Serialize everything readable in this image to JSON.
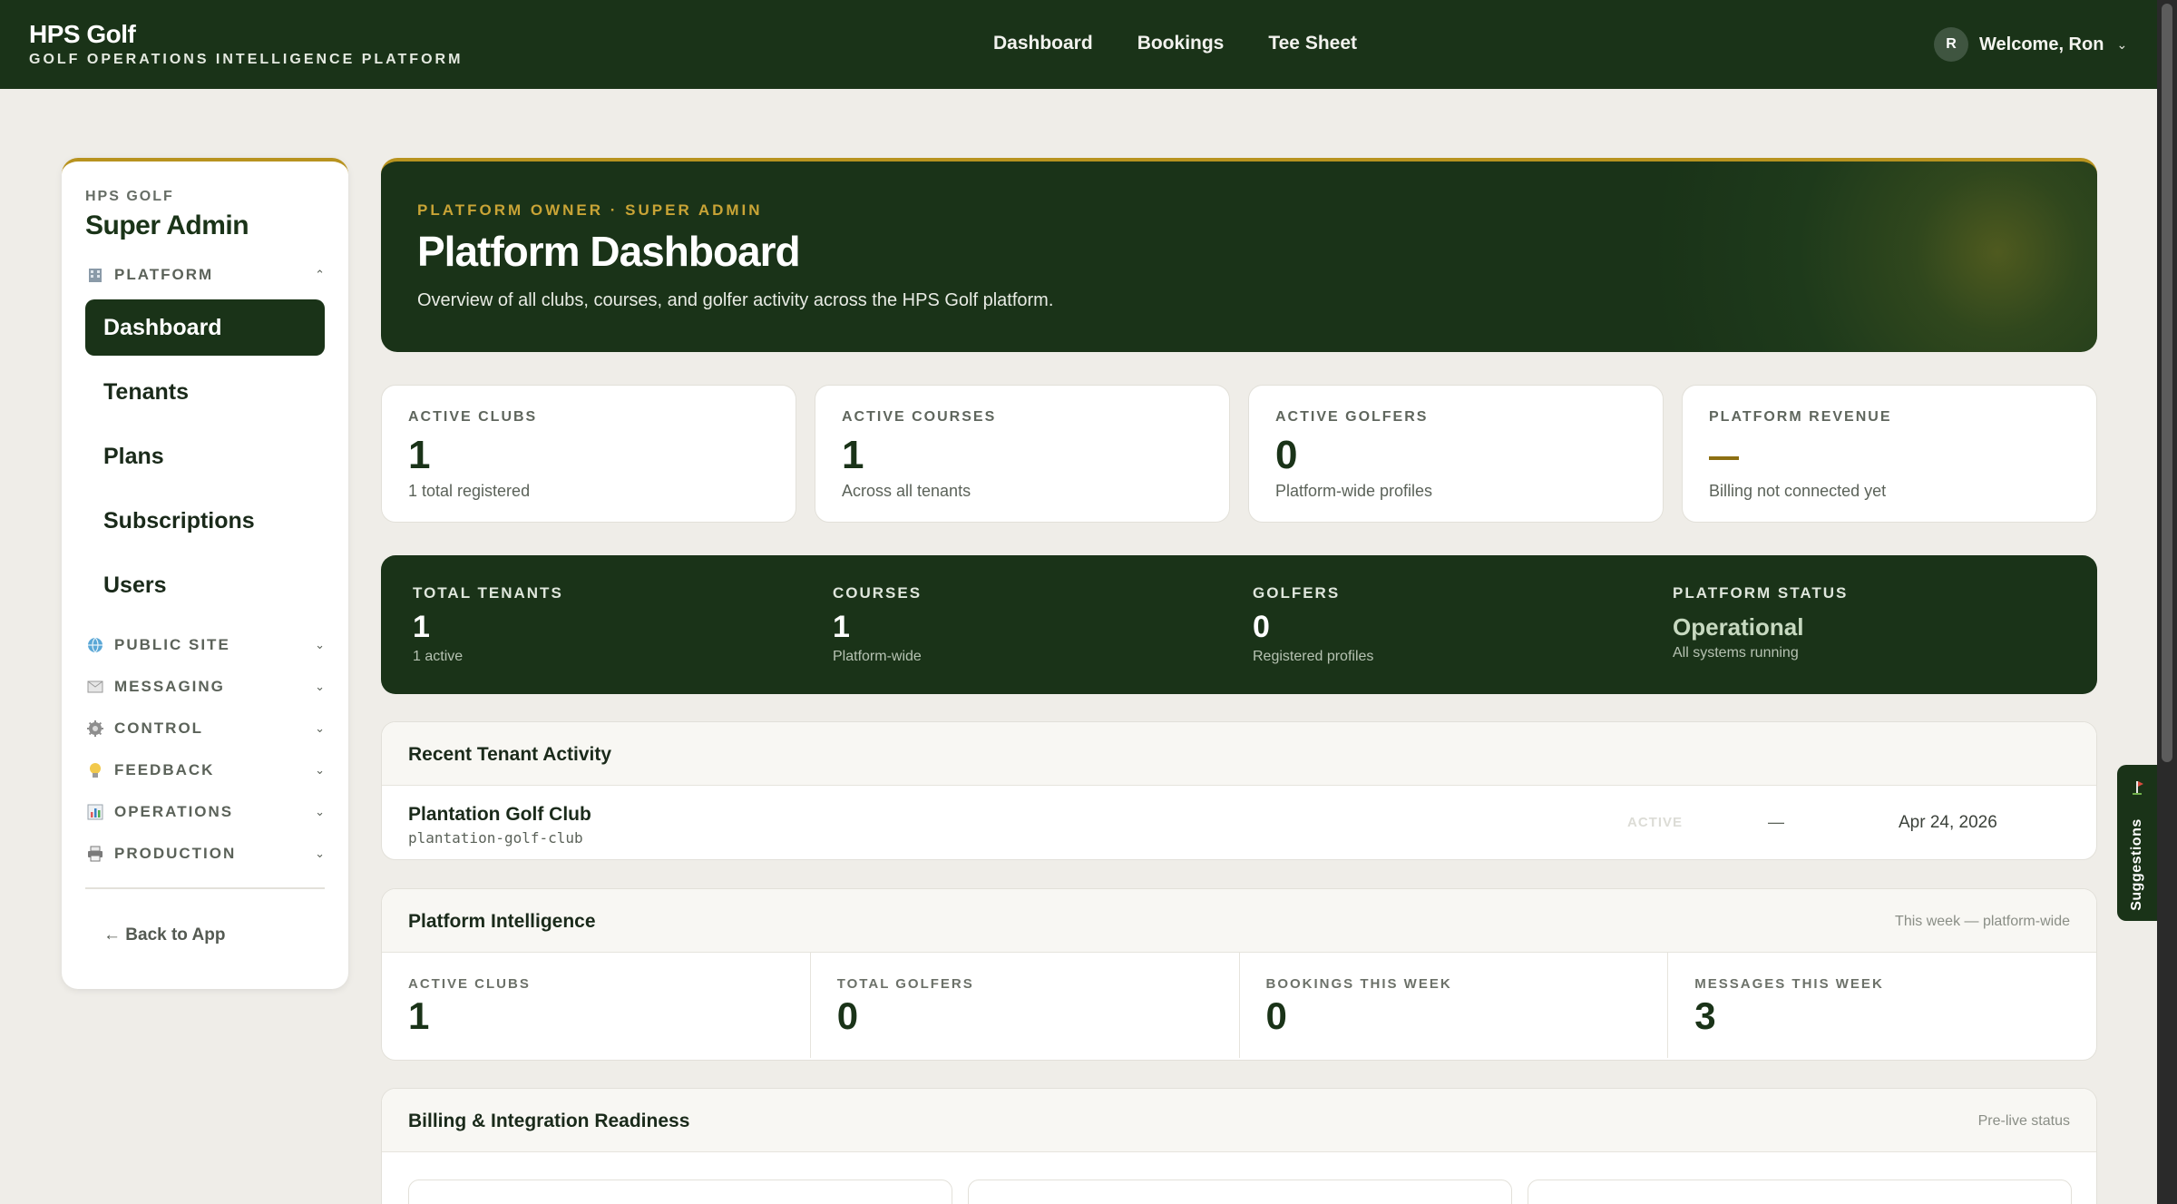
{
  "topbar": {
    "brand_title": "HPS Golf",
    "brand_subtitle": "GOLF OPERATIONS INTELLIGENCE PLATFORM",
    "nav": [
      "Dashboard",
      "Bookings",
      "Tee Sheet"
    ],
    "user_initial": "R",
    "welcome": "Welcome, Ron",
    "user_chevron": "⌄"
  },
  "sidebar": {
    "org": "HPS GOLF",
    "role": "Super Admin",
    "platform_section": {
      "label": "PLATFORM",
      "icon": "building-icon",
      "caret": "⌃"
    },
    "items": [
      "Dashboard",
      "Tenants",
      "Plans",
      "Subscriptions",
      "Users"
    ],
    "active_item": "Dashboard",
    "sections": [
      {
        "label": "PUBLIC SITE",
        "icon": "globe-icon",
        "caret": "⌄"
      },
      {
        "label": "MESSAGING",
        "icon": "envelope-icon",
        "caret": "⌄"
      },
      {
        "label": "CONTROL",
        "icon": "gear-icon",
        "caret": "⌄"
      },
      {
        "label": "FEEDBACK",
        "icon": "lightbulb-icon",
        "caret": "⌄"
      },
      {
        "label": "OPERATIONS",
        "icon": "bar-chart-icon",
        "caret": "⌄"
      },
      {
        "label": "PRODUCTION",
        "icon": "printer-icon",
        "caret": "⌄"
      }
    ],
    "back_link": "← Back to App"
  },
  "hero": {
    "eyebrow": "PLATFORM OWNER · SUPER ADMIN",
    "title": "Platform Dashboard",
    "description": "Overview of all clubs, courses, and golfer activity across the HPS Golf platform."
  },
  "stats": [
    {
      "label": "ACTIVE CLUBS",
      "value": "1",
      "sub": "1 total registered"
    },
    {
      "label": "ACTIVE COURSES",
      "value": "1",
      "sub": "Across all tenants"
    },
    {
      "label": "ACTIVE GOLFERS",
      "value": "0",
      "sub": "Platform-wide profiles"
    },
    {
      "label": "PLATFORM REVENUE",
      "value": "—",
      "sub": "Billing not connected yet"
    }
  ],
  "summary": [
    {
      "label": "TOTAL TENANTS",
      "value": "1",
      "sub": "1 active"
    },
    {
      "label": "COURSES",
      "value": "1",
      "sub": "Platform-wide"
    },
    {
      "label": "GOLFERS",
      "value": "0",
      "sub": "Registered profiles"
    },
    {
      "label": "PLATFORM STATUS",
      "value": "Operational",
      "sub": "All systems running"
    }
  ],
  "recent_activity": {
    "title": "Recent Tenant Activity",
    "rows": [
      {
        "name": "Plantation Golf Club",
        "slug": "plantation-golf-club",
        "status": "ACTIVE",
        "plan": "—",
        "date": "Apr 24, 2026"
      }
    ]
  },
  "intelligence": {
    "title": "Platform Intelligence",
    "note": "This week — platform-wide",
    "cells": [
      {
        "label": "ACTIVE CLUBS",
        "value": "1"
      },
      {
        "label": "TOTAL GOLFERS",
        "value": "0"
      },
      {
        "label": "BOOKINGS THIS WEEK",
        "value": "0"
      },
      {
        "label": "MESSAGES THIS WEEK",
        "value": "3"
      }
    ]
  },
  "billing": {
    "title": "Billing & Integration Readiness",
    "note": "Pre-live status"
  },
  "suggestions": {
    "label": "Suggestions",
    "icon": "flag-icon"
  },
  "colors": {
    "primary": "#1a3318",
    "accent_gold": "#b8931f",
    "background": "#efede8"
  }
}
